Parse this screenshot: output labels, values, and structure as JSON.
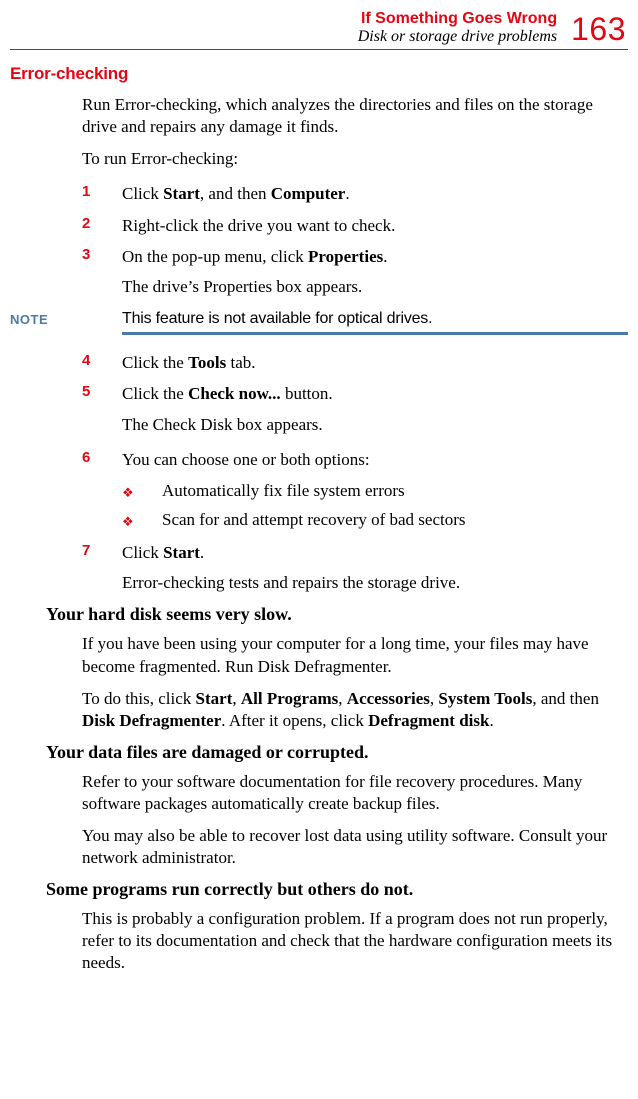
{
  "header": {
    "chapter": "If Something Goes Wrong",
    "section": "Disk or storage drive problems",
    "page_number": "163"
  },
  "s1": {
    "title": "Error-checking",
    "intro": "Run Error-checking, which analyzes the directories and files on the storage drive and repairs any damage it finds.",
    "torun": "To run Error-checking:",
    "step1_a": "Click ",
    "step1_b": "Start",
    "step1_c": ", and then ",
    "step1_d": "Computer",
    "step1_e": ".",
    "step2": "Right-click the drive you want to check.",
    "step3_a": "On the pop-up menu, click ",
    "step3_b": "Properties",
    "step3_c": ".",
    "step3_cont": "The drive’s Properties box appears.",
    "note_label": "NOTE",
    "note_text": "This feature is not available for optical drives.",
    "step4_a": "Click the ",
    "step4_b": "Tools",
    "step4_c": " tab.",
    "step5_a": "Click the ",
    "step5_b": "Check now...",
    "step5_c": " button.",
    "step5_cont": "The Check Disk box appears.",
    "step6": "You can choose one or both options:",
    "bullet1": "Automatically fix file system errors",
    "bullet2": "Scan for and attempt recovery of bad sectors",
    "step7_a": "Click ",
    "step7_b": "Start",
    "step7_c": ".",
    "step7_cont": "Error-checking tests and repairs the storage drive."
  },
  "s2": {
    "title": "Your hard disk seems very slow.",
    "p1": "If you have been using your computer for a long time, your files may have become fragmented. Run Disk Defragmenter.",
    "p2_a": "To do this, click ",
    "p2_b": "Start",
    "p2_c": ", ",
    "p2_d": "All Programs",
    "p2_e": ", ",
    "p2_f": "Accessories",
    "p2_g": ", ",
    "p2_h": "System Tools",
    "p2_i": ", and then ",
    "p2_j": "Disk Defragmenter",
    "p2_k": ". After it opens, click ",
    "p2_l": "Defragment disk",
    "p2_m": "."
  },
  "s3": {
    "title": "Your data files are damaged or corrupted.",
    "p1": "Refer to your software documentation for file recovery procedures. Many software packages automatically create backup files.",
    "p2": "You may also be able to recover lost data using utility software. Consult your network administrator."
  },
  "s4": {
    "title": "Some programs run correctly but others do not.",
    "p1": "This is probably a configuration problem. If a program does not run properly, refer to its documentation and check that the hardware configuration meets its needs."
  },
  "nums": {
    "n1": "1",
    "n2": "2",
    "n3": "3",
    "n4": "4",
    "n5": "5",
    "n6": "6",
    "n7": "7"
  },
  "diamond": "❖"
}
